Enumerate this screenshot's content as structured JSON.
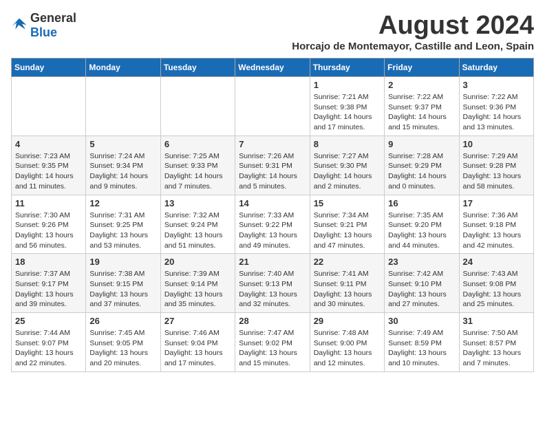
{
  "logo": {
    "general": "General",
    "blue": "Blue"
  },
  "header": {
    "title": "August 2024",
    "subtitle": "Horcajo de Montemayor, Castille and Leon, Spain"
  },
  "days_of_week": [
    "Sunday",
    "Monday",
    "Tuesday",
    "Wednesday",
    "Thursday",
    "Friday",
    "Saturday"
  ],
  "weeks": [
    [
      {
        "day": "",
        "info": ""
      },
      {
        "day": "",
        "info": ""
      },
      {
        "day": "",
        "info": ""
      },
      {
        "day": "",
        "info": ""
      },
      {
        "day": "1",
        "info": "Sunrise: 7:21 AM\nSunset: 9:38 PM\nDaylight: 14 hours and 17 minutes."
      },
      {
        "day": "2",
        "info": "Sunrise: 7:22 AM\nSunset: 9:37 PM\nDaylight: 14 hours and 15 minutes."
      },
      {
        "day": "3",
        "info": "Sunrise: 7:22 AM\nSunset: 9:36 PM\nDaylight: 14 hours and 13 minutes."
      }
    ],
    [
      {
        "day": "4",
        "info": "Sunrise: 7:23 AM\nSunset: 9:35 PM\nDaylight: 14 hours and 11 minutes."
      },
      {
        "day": "5",
        "info": "Sunrise: 7:24 AM\nSunset: 9:34 PM\nDaylight: 14 hours and 9 minutes."
      },
      {
        "day": "6",
        "info": "Sunrise: 7:25 AM\nSunset: 9:33 PM\nDaylight: 14 hours and 7 minutes."
      },
      {
        "day": "7",
        "info": "Sunrise: 7:26 AM\nSunset: 9:31 PM\nDaylight: 14 hours and 5 minutes."
      },
      {
        "day": "8",
        "info": "Sunrise: 7:27 AM\nSunset: 9:30 PM\nDaylight: 14 hours and 2 minutes."
      },
      {
        "day": "9",
        "info": "Sunrise: 7:28 AM\nSunset: 9:29 PM\nDaylight: 14 hours and 0 minutes."
      },
      {
        "day": "10",
        "info": "Sunrise: 7:29 AM\nSunset: 9:28 PM\nDaylight: 13 hours and 58 minutes."
      }
    ],
    [
      {
        "day": "11",
        "info": "Sunrise: 7:30 AM\nSunset: 9:26 PM\nDaylight: 13 hours and 56 minutes."
      },
      {
        "day": "12",
        "info": "Sunrise: 7:31 AM\nSunset: 9:25 PM\nDaylight: 13 hours and 53 minutes."
      },
      {
        "day": "13",
        "info": "Sunrise: 7:32 AM\nSunset: 9:24 PM\nDaylight: 13 hours and 51 minutes."
      },
      {
        "day": "14",
        "info": "Sunrise: 7:33 AM\nSunset: 9:22 PM\nDaylight: 13 hours and 49 minutes."
      },
      {
        "day": "15",
        "info": "Sunrise: 7:34 AM\nSunset: 9:21 PM\nDaylight: 13 hours and 47 minutes."
      },
      {
        "day": "16",
        "info": "Sunrise: 7:35 AM\nSunset: 9:20 PM\nDaylight: 13 hours and 44 minutes."
      },
      {
        "day": "17",
        "info": "Sunrise: 7:36 AM\nSunset: 9:18 PM\nDaylight: 13 hours and 42 minutes."
      }
    ],
    [
      {
        "day": "18",
        "info": "Sunrise: 7:37 AM\nSunset: 9:17 PM\nDaylight: 13 hours and 39 minutes."
      },
      {
        "day": "19",
        "info": "Sunrise: 7:38 AM\nSunset: 9:15 PM\nDaylight: 13 hours and 37 minutes."
      },
      {
        "day": "20",
        "info": "Sunrise: 7:39 AM\nSunset: 9:14 PM\nDaylight: 13 hours and 35 minutes."
      },
      {
        "day": "21",
        "info": "Sunrise: 7:40 AM\nSunset: 9:13 PM\nDaylight: 13 hours and 32 minutes."
      },
      {
        "day": "22",
        "info": "Sunrise: 7:41 AM\nSunset: 9:11 PM\nDaylight: 13 hours and 30 minutes."
      },
      {
        "day": "23",
        "info": "Sunrise: 7:42 AM\nSunset: 9:10 PM\nDaylight: 13 hours and 27 minutes."
      },
      {
        "day": "24",
        "info": "Sunrise: 7:43 AM\nSunset: 9:08 PM\nDaylight: 13 hours and 25 minutes."
      }
    ],
    [
      {
        "day": "25",
        "info": "Sunrise: 7:44 AM\nSunset: 9:07 PM\nDaylight: 13 hours and 22 minutes."
      },
      {
        "day": "26",
        "info": "Sunrise: 7:45 AM\nSunset: 9:05 PM\nDaylight: 13 hours and 20 minutes."
      },
      {
        "day": "27",
        "info": "Sunrise: 7:46 AM\nSunset: 9:04 PM\nDaylight: 13 hours and 17 minutes."
      },
      {
        "day": "28",
        "info": "Sunrise: 7:47 AM\nSunset: 9:02 PM\nDaylight: 13 hours and 15 minutes."
      },
      {
        "day": "29",
        "info": "Sunrise: 7:48 AM\nSunset: 9:00 PM\nDaylight: 13 hours and 12 minutes."
      },
      {
        "day": "30",
        "info": "Sunrise: 7:49 AM\nSunset: 8:59 PM\nDaylight: 13 hours and 10 minutes."
      },
      {
        "day": "31",
        "info": "Sunrise: 7:50 AM\nSunset: 8:57 PM\nDaylight: 13 hours and 7 minutes."
      }
    ]
  ]
}
